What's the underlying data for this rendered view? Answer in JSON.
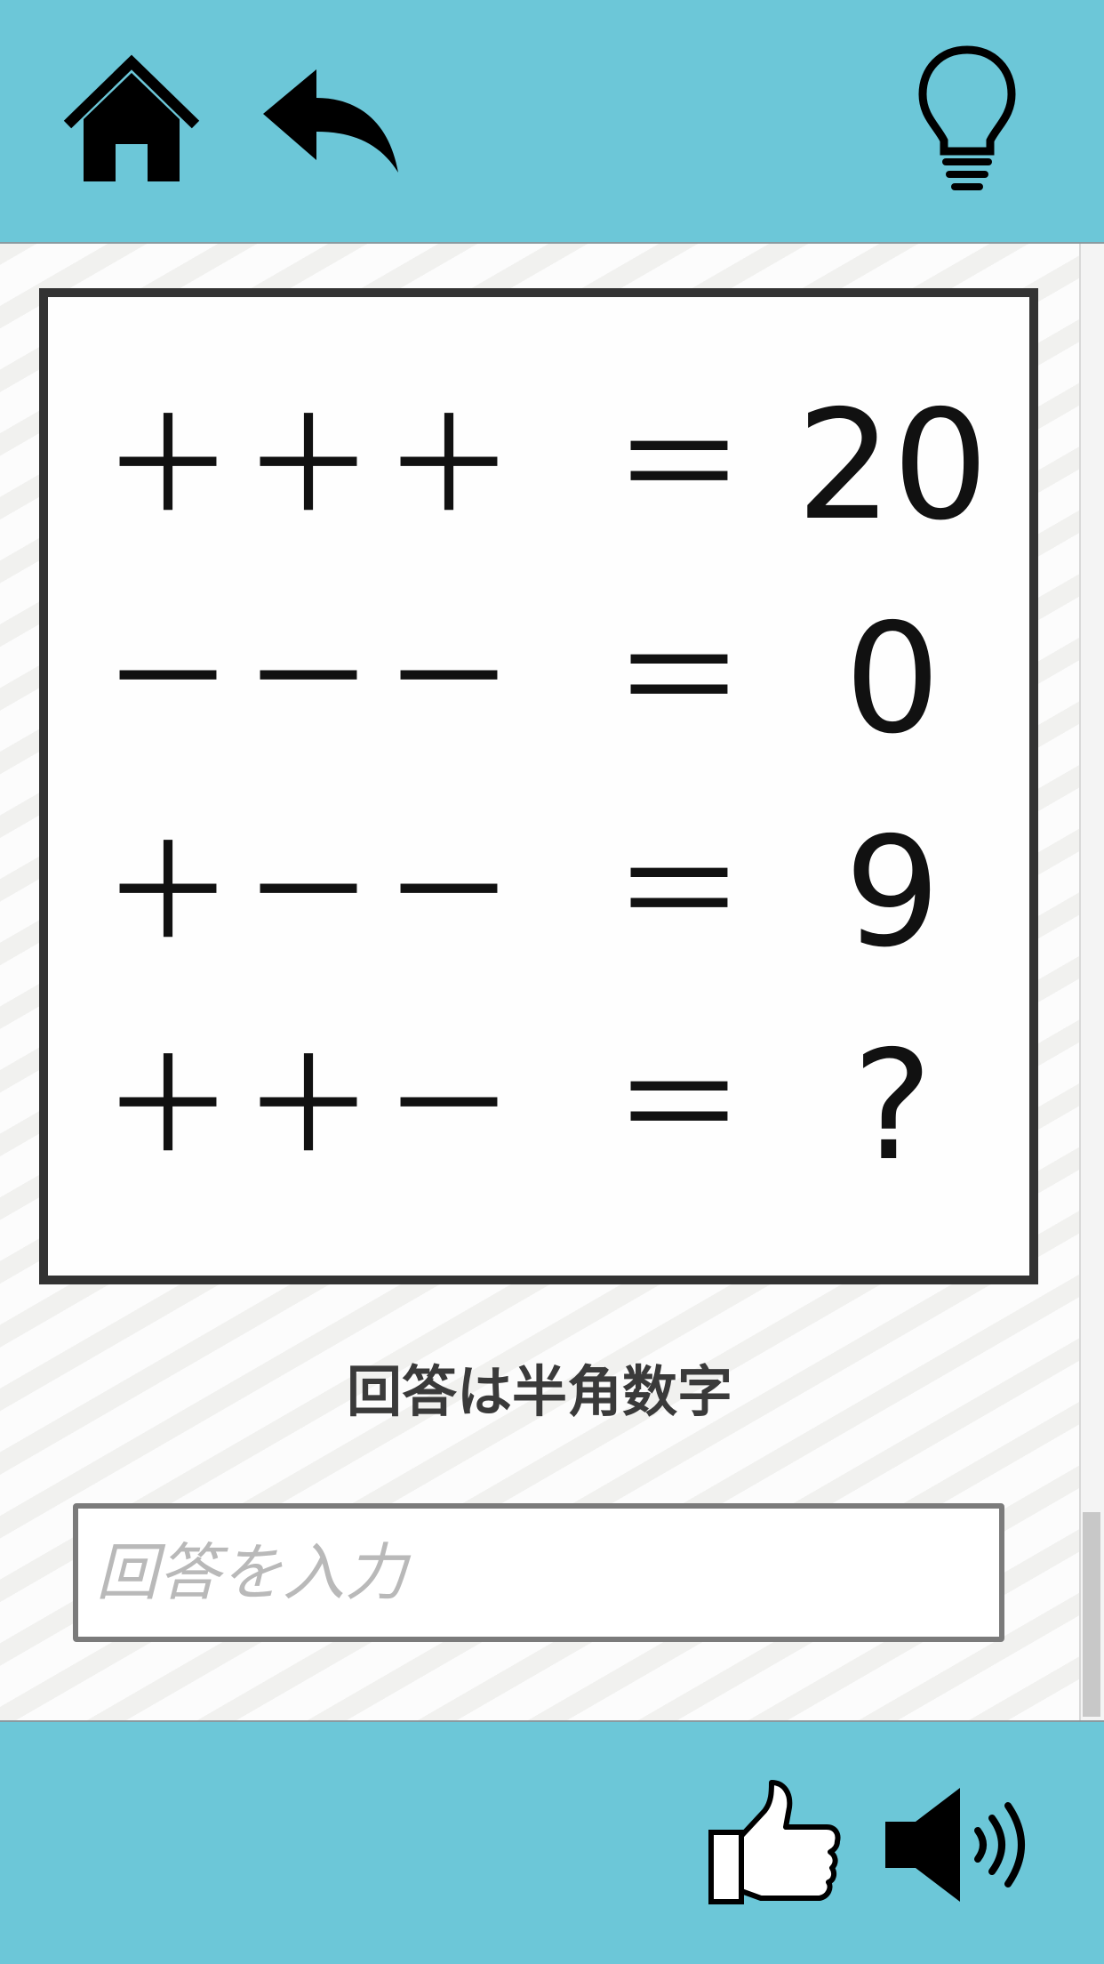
{
  "header": {
    "home_icon": "home-icon",
    "back_icon": "undo-arrow-icon",
    "hint_icon": "lightbulb-icon",
    "background_color": "#6cc7d8"
  },
  "puzzle": {
    "rows": [
      {
        "ops": "＋＋＋",
        "eq": "＝",
        "result": "20"
      },
      {
        "ops": "－－－",
        "eq": "＝",
        "result": "0"
      },
      {
        "ops": "＋－－",
        "eq": "＝",
        "result": "9"
      },
      {
        "ops": "＋＋－",
        "eq": "＝",
        "result": "?"
      }
    ]
  },
  "instruction": "回答は半角数字",
  "answer": {
    "value": "",
    "placeholder": "回答を入力"
  },
  "footer": {
    "like_icon": "thumbs-up-icon",
    "sound_icon": "speaker-icon",
    "background_color": "#6cc7d8"
  }
}
